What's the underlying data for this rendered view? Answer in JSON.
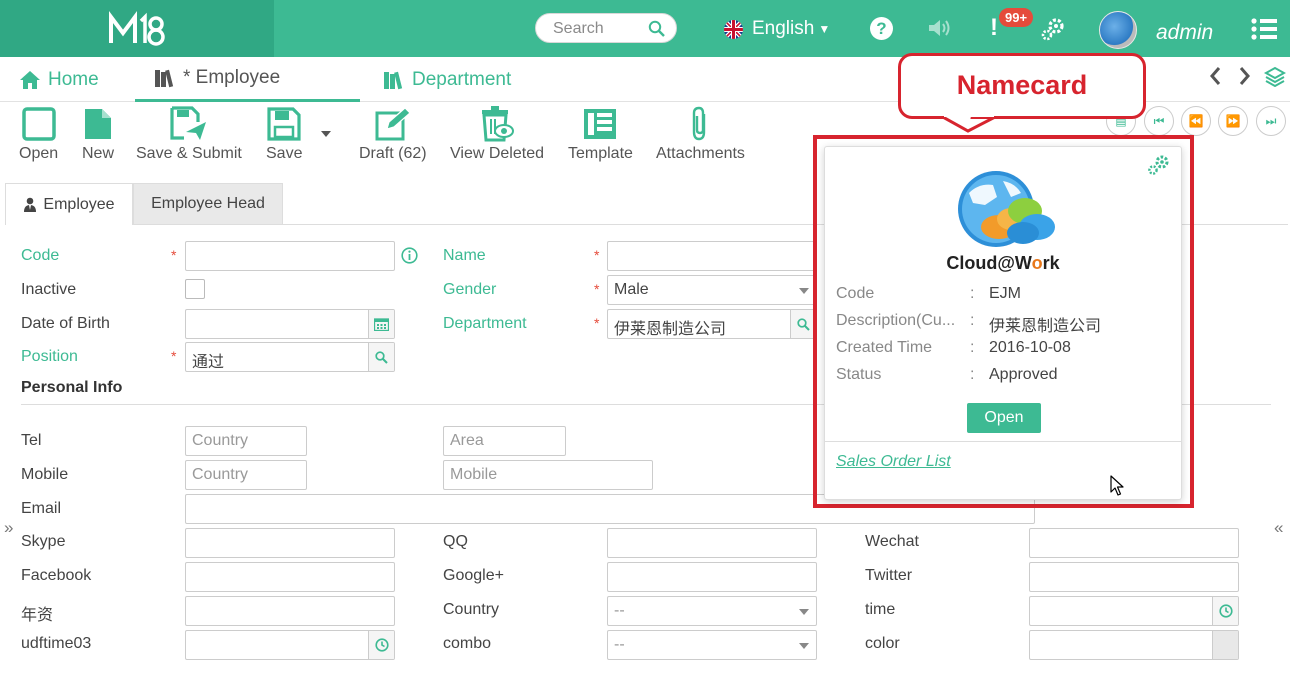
{
  "header": {
    "search_placeholder": "Search",
    "language": "English",
    "help": "?",
    "notification_mark": "!",
    "notification_badge": "99+",
    "username": "admin"
  },
  "nav": {
    "tabs": [
      {
        "label": "Home"
      },
      {
        "label": "* Employee"
      },
      {
        "label": "Department"
      }
    ]
  },
  "toolbar": {
    "items": [
      {
        "label": "Open"
      },
      {
        "label": "New"
      },
      {
        "label": "Save & Submit"
      },
      {
        "label": "Save"
      },
      {
        "label": "Draft (62)"
      },
      {
        "label": "View Deleted"
      },
      {
        "label": "Template"
      },
      {
        "label": "Attachments"
      }
    ]
  },
  "form_tabs": [
    {
      "label": "Employee"
    },
    {
      "label": "Employee Head"
    }
  ],
  "fields": {
    "code_label": "Code",
    "name_label": "Name",
    "inactive_label": "Inactive",
    "gender_label": "Gender",
    "gender_value": "Male",
    "dob_label": "Date of Birth",
    "department_label": "Department",
    "department_value": "伊莱恩制造公司",
    "position_label": "Position",
    "position_value": "通过",
    "personal_info": "Personal Info",
    "tel_label": "Tel",
    "tel_country_ph": "Country",
    "tel_area_ph": "Area",
    "mobile_label": "Mobile",
    "mobile_country_ph": "Country",
    "mobile_mobile_ph": "Mobile",
    "email_label": "Email",
    "skype_label": "Skype",
    "qq_label": "QQ",
    "wechat_label": "Wechat",
    "facebook_label": "Facebook",
    "google_label": "Google+",
    "twitter_label": "Twitter",
    "nianzi_label": "年资",
    "country_label": "Country",
    "country_value": "--",
    "time_label": "time",
    "udftime_label": "udftime03",
    "combo_label": "combo",
    "combo_value": "--",
    "color_label": "color"
  },
  "annotation": {
    "callout": "Namecard"
  },
  "namecard": {
    "brand_pre": "Cloud@W",
    "brand_o": "o",
    "brand_post": "rk",
    "rows": [
      {
        "key": "Code",
        "value": "EJM"
      },
      {
        "key": "Description(Cu...",
        "value": "伊莱恩制造公司"
      },
      {
        "key": "Created Time",
        "value": "2016-10-08"
      },
      {
        "key": "Status",
        "value": "Approved"
      }
    ],
    "separator": ":",
    "open_button": "Open",
    "link": "Sales Order List"
  },
  "colors": {
    "brand_green": "#3dba93",
    "annotation_red": "#d7242e",
    "required_red": "#e54b3b"
  }
}
